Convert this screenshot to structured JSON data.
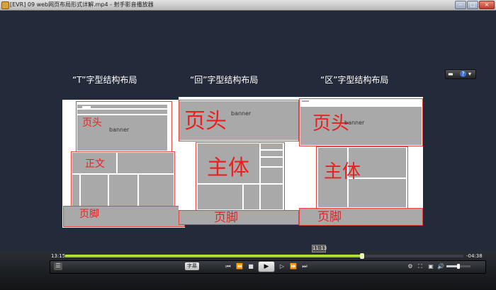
{
  "window": {
    "title": "[EVR] 09 web网页布局形式详解.mp4 - 射手影音播放器",
    "btn_min": "–",
    "btn_max": "□",
    "btn_close": "×"
  },
  "video": {
    "headings": [
      "“T”字型结构布局",
      "“回”字型结构布局",
      "“区”字型结构布局"
    ],
    "t_layout": {
      "header": "页头",
      "body": "正文",
      "footer": "页脚",
      "banner": "banner"
    },
    "hui_layout": {
      "header": "页头",
      "body": "主体",
      "footer": "页脚",
      "banner": "banner"
    },
    "qu_layout": {
      "header": "页头",
      "body": "主体",
      "footer": "页脚",
      "banner": "banner"
    },
    "float_help": "?"
  },
  "player": {
    "time_elapsed": "13:15",
    "time_remaining": "-04:38",
    "hover_time": "11:13",
    "progress": 0.745,
    "volume": 0.5,
    "subtitle_label": "字幕",
    "icons": {
      "playlist": "playlist-icon",
      "prev": "skip-back-icon",
      "rewind": "rewind-icon",
      "stop": "stop-icon",
      "play": "play-icon",
      "step": "step-forward-icon",
      "forward": "fast-forward-icon",
      "next": "skip-forward-icon",
      "settings": "settings-icon",
      "fullscreen": "fullscreen-icon",
      "window": "window-icon",
      "volume": "volume-icon"
    },
    "colors": {
      "progress": "#a7d62a",
      "annotation": "#ec1f1f"
    }
  }
}
